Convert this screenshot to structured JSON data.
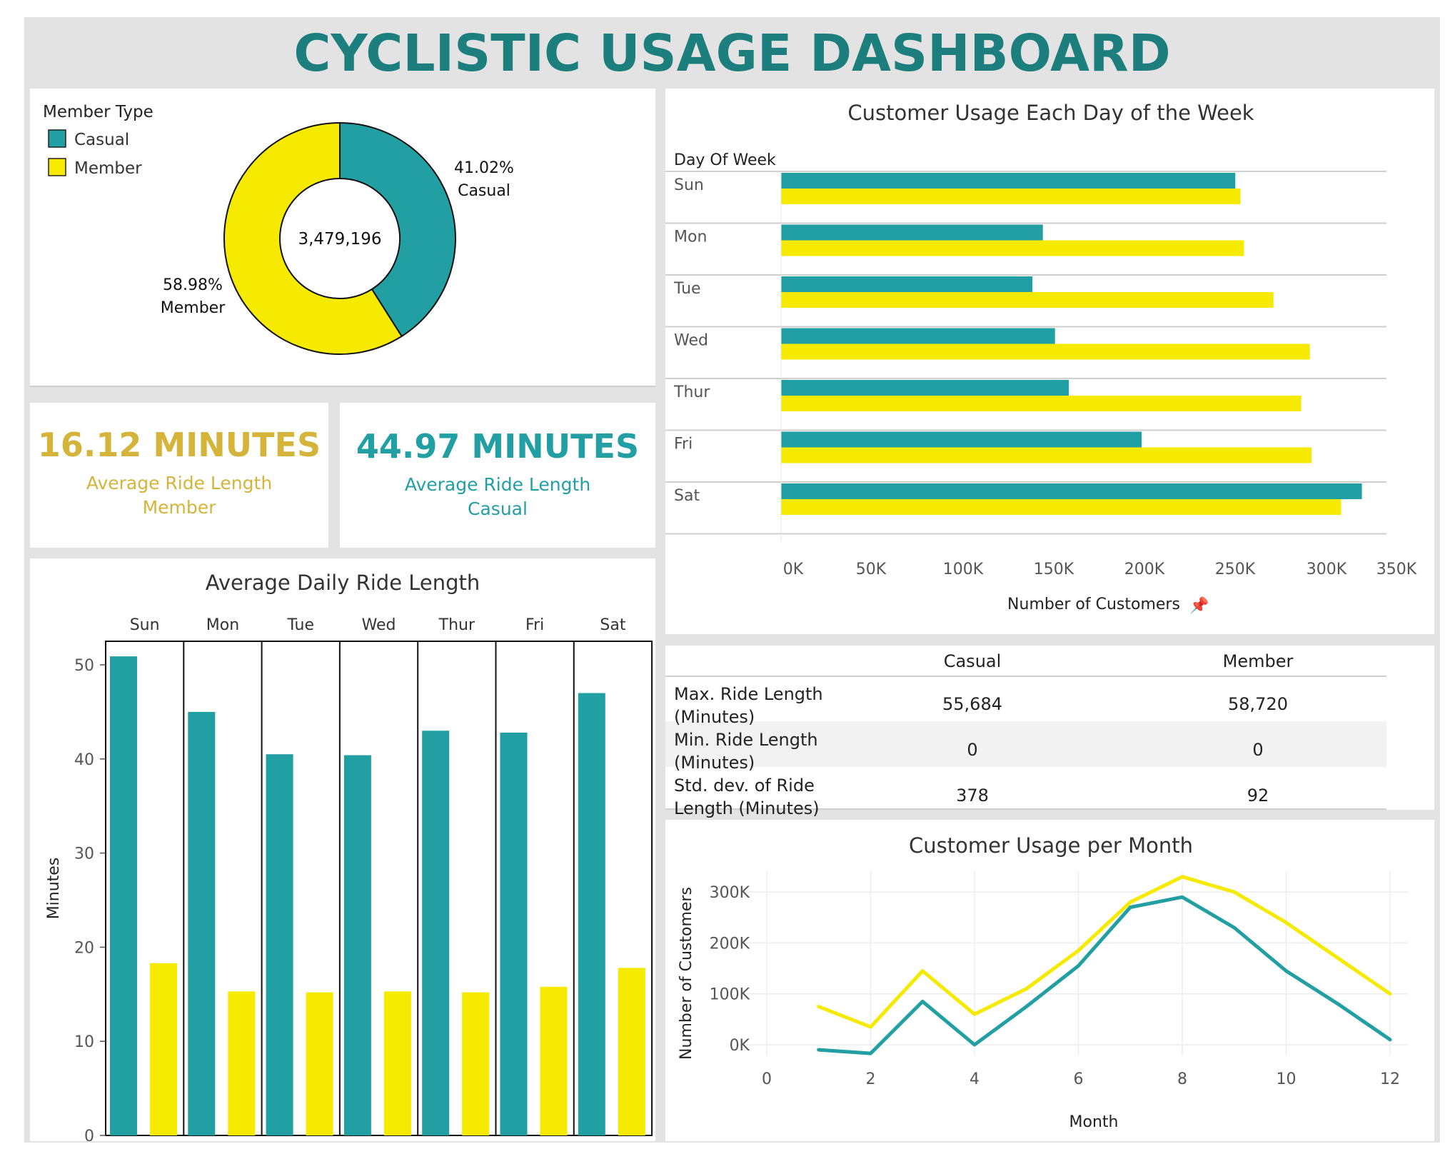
{
  "title": "CYCLISTIC USAGE DASHBOARD",
  "colors": {
    "casual": "#229fa3",
    "member": "#f5ea00",
    "title": "#1c7f7d",
    "kpi_member": "#d4b43a",
    "kpi_casual": "#229fa3"
  },
  "donut": {
    "legend_title": "Member Type",
    "legend": [
      "Casual",
      "Member"
    ],
    "total_label": "3,479,196",
    "casual_pct": "41.02%",
    "casual_label": "Casual",
    "member_pct": "58.98%",
    "member_label": "Member"
  },
  "kpi_member": {
    "value": "16.12 MINUTES",
    "line1": "Average Ride Length",
    "line2": "Member"
  },
  "kpi_casual": {
    "value": "44.97 MINUTES",
    "line1": "Average Ride Length",
    "line2": "Casual"
  },
  "stats_table": {
    "headers": [
      "Casual",
      "Member"
    ],
    "rows": [
      {
        "label1": "Max. Ride Length",
        "label2": "(Minutes)",
        "casual": "55,684",
        "member": "58,720"
      },
      {
        "label1": "Min. Ride Length",
        "label2": "(Minutes)",
        "casual": "0",
        "member": "0"
      },
      {
        "label1": "Std. dev. of Ride",
        "label2": "Length (Minutes)",
        "casual": "378",
        "member": "92"
      }
    ]
  },
  "chart_data": [
    {
      "type": "pie",
      "categories": [
        "Casual",
        "Member"
      ],
      "values": [
        41.02,
        58.98
      ],
      "total": 3479196,
      "legend_title": "Member Type"
    },
    {
      "type": "bar",
      "title": "Customer Usage Each Day of the Week",
      "orientation": "horizontal",
      "row_header": "Day Of Week",
      "categories": [
        "Sun",
        "Mon",
        "Tue",
        "Wed",
        "Thur",
        "Fri",
        "Sat"
      ],
      "series": [
        {
          "name": "Casual",
          "values": [
            262000,
            151000,
            145000,
            158000,
            166000,
            208000,
            335000
          ]
        },
        {
          "name": "Member",
          "values": [
            265000,
            267000,
            284000,
            305000,
            300000,
            306000,
            323000
          ]
        }
      ],
      "xlabel": "Number of Customers",
      "xlim": [
        0,
        350000
      ],
      "xticks": [
        "0K",
        "50K",
        "100K",
        "150K",
        "200K",
        "250K",
        "300K",
        "350K"
      ]
    },
    {
      "type": "bar",
      "title": "Average Daily Ride Length",
      "categories": [
        "Sun",
        "Mon",
        "Tue",
        "Wed",
        "Thur",
        "Fri",
        "Sat"
      ],
      "series": [
        {
          "name": "Casual",
          "values": [
            50.9,
            45.0,
            40.5,
            40.4,
            43.0,
            42.8,
            47.0
          ]
        },
        {
          "name": "Member",
          "values": [
            18.3,
            15.3,
            15.2,
            15.3,
            15.2,
            15.8,
            17.8
          ]
        }
      ],
      "ylabel": "Minutes",
      "ylim": [
        0,
        50
      ],
      "yticks": [
        "0",
        "10",
        "20",
        "30",
        "40",
        "50"
      ]
    },
    {
      "type": "line",
      "title": "Customer Usage per Month",
      "x": [
        1,
        2,
        3,
        4,
        5,
        6,
        7,
        8,
        9,
        10,
        11,
        12
      ],
      "series": [
        {
          "name": "Casual",
          "values": [
            -10000,
            -17000,
            85000,
            0,
            75000,
            155000,
            270000,
            290000,
            230000,
            145000,
            80000,
            10000
          ]
        },
        {
          "name": "Member",
          "values": [
            75000,
            35000,
            145000,
            60000,
            110000,
            185000,
            280000,
            330000,
            300000,
            240000,
            170000,
            100000
          ]
        }
      ],
      "xlabel": "Month",
      "ylabel": "Number of Customers",
      "xticks": [
        "0",
        "2",
        "4",
        "6",
        "8",
        "10",
        "12"
      ],
      "yticks": [
        "0K",
        "100K",
        "200K",
        "300K"
      ]
    }
  ]
}
